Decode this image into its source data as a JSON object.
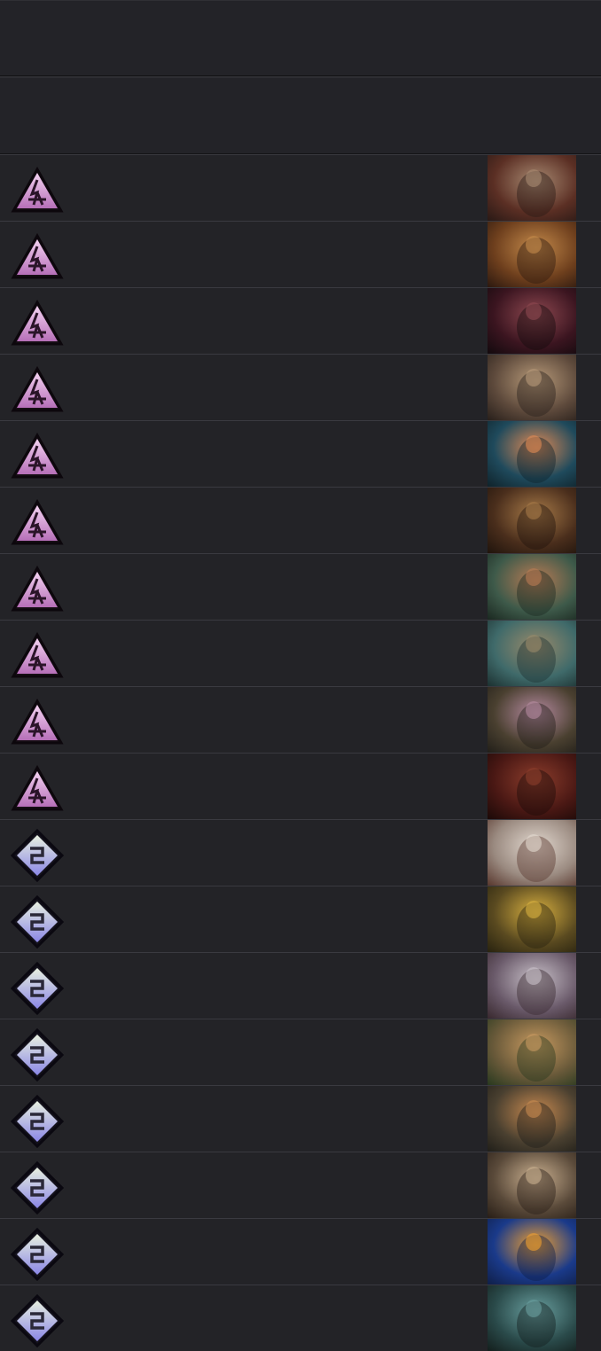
{
  "header_rows": [
    "",
    ""
  ],
  "icon_names": {
    "triangle": "triangle-rune-icon",
    "diamond": "diamond-rune-icon"
  },
  "colors": {
    "triangle_top": "#f3d2f1",
    "triangle_bottom": "#b66fb8",
    "diamond_top": "#e8f0e0",
    "diamond_bottom": "#8a86e6",
    "row_bg": "#232327",
    "divider": "#3a3a40"
  },
  "cards": [
    {
      "icon": "triangle",
      "art_name": "card-art-stone-fist",
      "palette": [
        "#5b2f24",
        "#a88a72",
        "#2b1a16"
      ]
    },
    {
      "icon": "triangle",
      "art_name": "card-art-hooded-woman",
      "palette": [
        "#6e3f1d",
        "#c48a4b",
        "#2e1a10"
      ]
    },
    {
      "icon": "triangle",
      "art_name": "card-art-red-cloaked-figure",
      "palette": [
        "#3b1520",
        "#8e4850",
        "#140a0e"
      ]
    },
    {
      "icon": "triangle",
      "art_name": "card-art-armored-warrior",
      "palette": [
        "#5e4a3c",
        "#b79a79",
        "#2a211c"
      ]
    },
    {
      "icon": "triangle",
      "art_name": "card-art-forest-wanderer",
      "palette": [
        "#1f4a5c",
        "#e08a55",
        "#10242c"
      ]
    },
    {
      "icon": "triangle",
      "art_name": "card-art-sleeping-elder",
      "palette": [
        "#4a2e1c",
        "#a77a48",
        "#21150d"
      ]
    },
    {
      "icon": "triangle",
      "art_name": "card-art-embracing-pair",
      "palette": [
        "#3e5a4a",
        "#b97b54",
        "#1c2a22"
      ]
    },
    {
      "icon": "triangle",
      "art_name": "card-art-misty-soldier",
      "palette": [
        "#3f6a6a",
        "#9a8a6a",
        "#1e3333"
      ]
    },
    {
      "icon": "triangle",
      "art_name": "card-art-hillside-village",
      "palette": [
        "#4a4030",
        "#b58aa0",
        "#23201a"
      ]
    },
    {
      "icon": "triangle",
      "art_name": "card-art-dark-reaper",
      "palette": [
        "#4a1814",
        "#8c3d2c",
        "#1d0a08"
      ]
    },
    {
      "icon": "diamond",
      "art_name": "card-art-wind-blade",
      "palette": [
        "#9a8a80",
        "#e2d8cf",
        "#5a3a30"
      ]
    },
    {
      "icon": "diamond",
      "art_name": "card-art-golden-brute",
      "palette": [
        "#5a4a20",
        "#d8b040",
        "#2a2410"
      ]
    },
    {
      "icon": "diamond",
      "art_name": "card-art-storm-mage",
      "palette": [
        "#6a5a6a",
        "#c8c0c8",
        "#3a2a30"
      ]
    },
    {
      "icon": "diamond",
      "art_name": "card-art-green-flame-warrior",
      "palette": [
        "#6a5a3a",
        "#c89a60",
        "#2a3a20"
      ]
    },
    {
      "icon": "diamond",
      "art_name": "card-art-autumn-knight",
      "palette": [
        "#4a4030",
        "#c88a50",
        "#22201a"
      ]
    },
    {
      "icon": "diamond",
      "art_name": "card-art-praying-monks",
      "palette": [
        "#5a4a3a",
        "#cab090",
        "#2a2018"
      ]
    },
    {
      "icon": "diamond",
      "art_name": "card-art-blue-sorcerer",
      "palette": [
        "#1a3a8a",
        "#f0a030",
        "#10204a"
      ]
    },
    {
      "icon": "diamond",
      "art_name": "card-art-teal-golem",
      "palette": [
        "#2a4a4a",
        "#6aa0a0",
        "#14201e"
      ]
    }
  ]
}
